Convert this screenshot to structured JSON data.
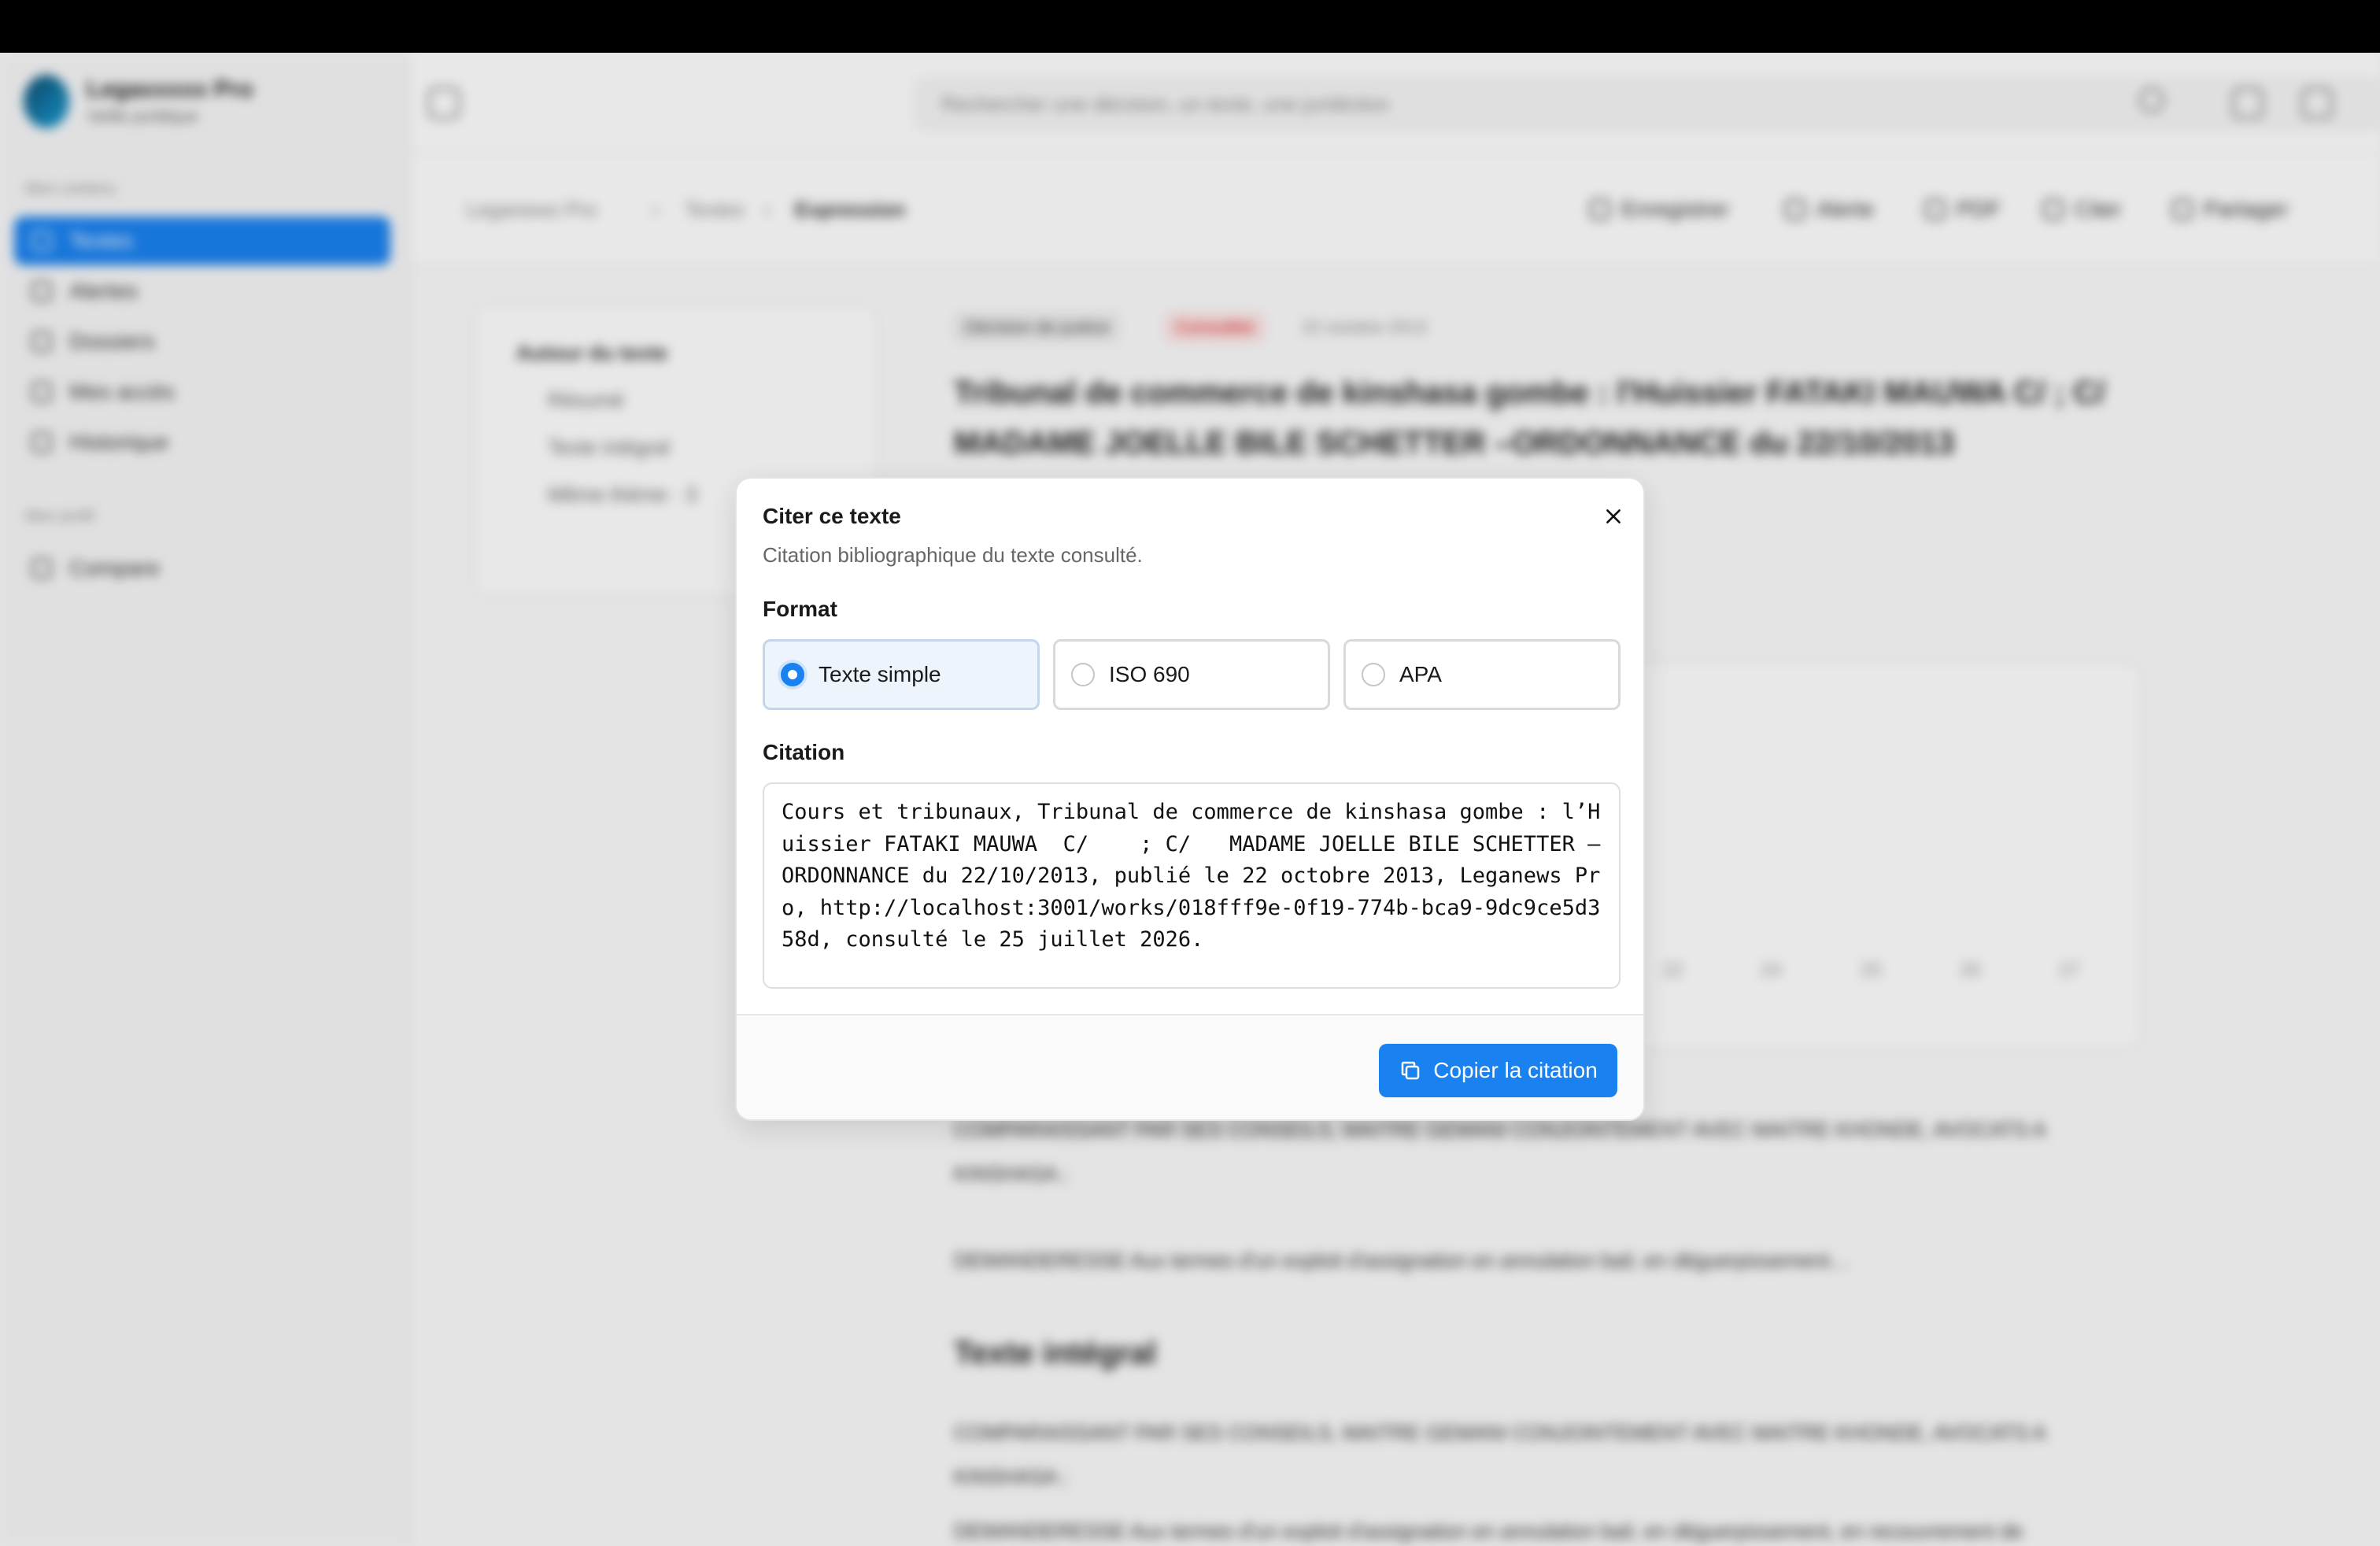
{
  "app": {
    "brand_name": "Legaxxxxx Pro",
    "brand_sub": "Veille juridique"
  },
  "sidebar": {
    "section_label": "Mon contenu",
    "items": [
      {
        "label": "Textes",
        "active": true
      },
      {
        "label": "Alertes"
      },
      {
        "label": "Dossiers"
      },
      {
        "label": "Mes accès"
      },
      {
        "label": "Historique"
      }
    ],
    "section2_label": "Mon profil",
    "items2": [
      {
        "label": "Compare"
      }
    ]
  },
  "header": {
    "search_placeholder": "Rechercher une décision, un texte, une juridiction"
  },
  "breadcrumb": [
    "Leganews Pro",
    "Textes",
    "Expression"
  ],
  "actions": [
    "Enregistrer",
    "Alerte",
    "PDF",
    "Citer",
    "Partager"
  ],
  "toc": {
    "title": "Autour du texte",
    "items": [
      "Résumé",
      "Texte intégral",
      "Même thème · 3"
    ]
  },
  "document": {
    "tag": "Décision de justice",
    "status": "Consultée",
    "date": "22 octobre 2013",
    "title": "Tribunal de commerce de kinshasa gombe : l'Huissier FATAKI MAUWA C/ ; C/ MADAME JOELLE BILE SCHETTER –ORDONNANCE du 22/10/2013",
    "chart_ticks": [
      "22",
      "24",
      "25",
      "26",
      "27"
    ],
    "para1": "COMPARAISSANT PAR SES CONSEILS, MAITRE GEMANI CONJOINTEMENT AVEC MAITRE KHONDE, AVOCATS A KINSHASA ;",
    "para2": "DEMANDERESSE Aux termes d'un exploit d'assignation en annulation bail, en déguerpissement…",
    "h2": "Texte intégral",
    "para3": "COMPARAISSANT PAR SES CONSEILS, MAITRE GEMANI CONJOINTEMENT AVEC MAITRE KHONDE, AVOCATS A KINSHASA ;",
    "para4": "DEMANDERESSE Aux termes d'un exploit d'assignation en annulation bail, en déguerpissement, en recouvrement de"
  },
  "modal": {
    "title": "Citer ce texte",
    "description": "Citation bibliographique du texte consulté.",
    "format_label": "Format",
    "formats": [
      {
        "label": "Texte simple",
        "selected": true
      },
      {
        "label": "ISO 690",
        "selected": false
      },
      {
        "label": "APA",
        "selected": false
      }
    ],
    "citation_label": "Citation",
    "citation_text": "Cours et tribunaux, Tribunal de commerce de kinshasa gombe : l’Huissier FATAKI MAUWA  C/    ; C/   MADAME JOELLE BILE SCHETTER –ORDONNANCE du 22/10/2013, publié le 22 octobre 2013, Leganews Pro, http://localhost:3001/works/018fff9e-0f19-774b-bca9-9dc9ce5d358d, consulté le 25 juillet 2026.",
    "copy_button": "Copier la citation"
  },
  "colors": {
    "accent": "#1a82f0",
    "selected_bg": "#eef4fb"
  },
  "icons": [
    "close-icon",
    "copy-icon",
    "search-icon",
    "radio-selected",
    "radio-empty"
  ]
}
